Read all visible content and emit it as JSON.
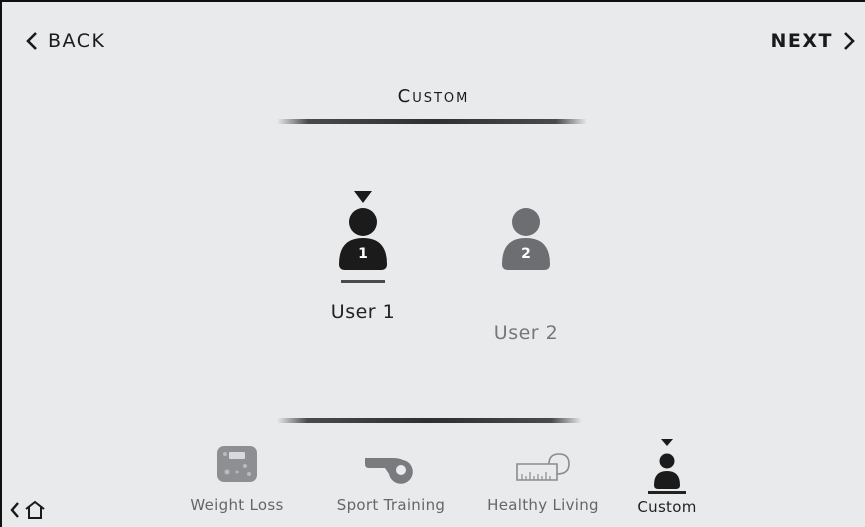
{
  "header": {
    "back_label": "BACK",
    "next_label": "NEXT",
    "title": "Custom"
  },
  "users": [
    {
      "label": "User 1",
      "badge": "1",
      "selected": true
    },
    {
      "label": "User 2",
      "badge": "2",
      "selected": false
    }
  ],
  "tabs": [
    {
      "label": "Weight Loss",
      "icon": "scale-icon",
      "active": false
    },
    {
      "label": "Sport Training",
      "icon": "whistle-icon",
      "active": false
    },
    {
      "label": "Healthy Living",
      "icon": "tape-measure-icon",
      "active": false
    },
    {
      "label": "Custom",
      "icon": "person-icon",
      "active": true
    }
  ],
  "colors": {
    "background": "#e9eaec",
    "selected_user": "#1b1b1b",
    "unselected_user": "#6d6e71",
    "text_dark": "#1a1a1a",
    "text_muted": "#777777"
  }
}
